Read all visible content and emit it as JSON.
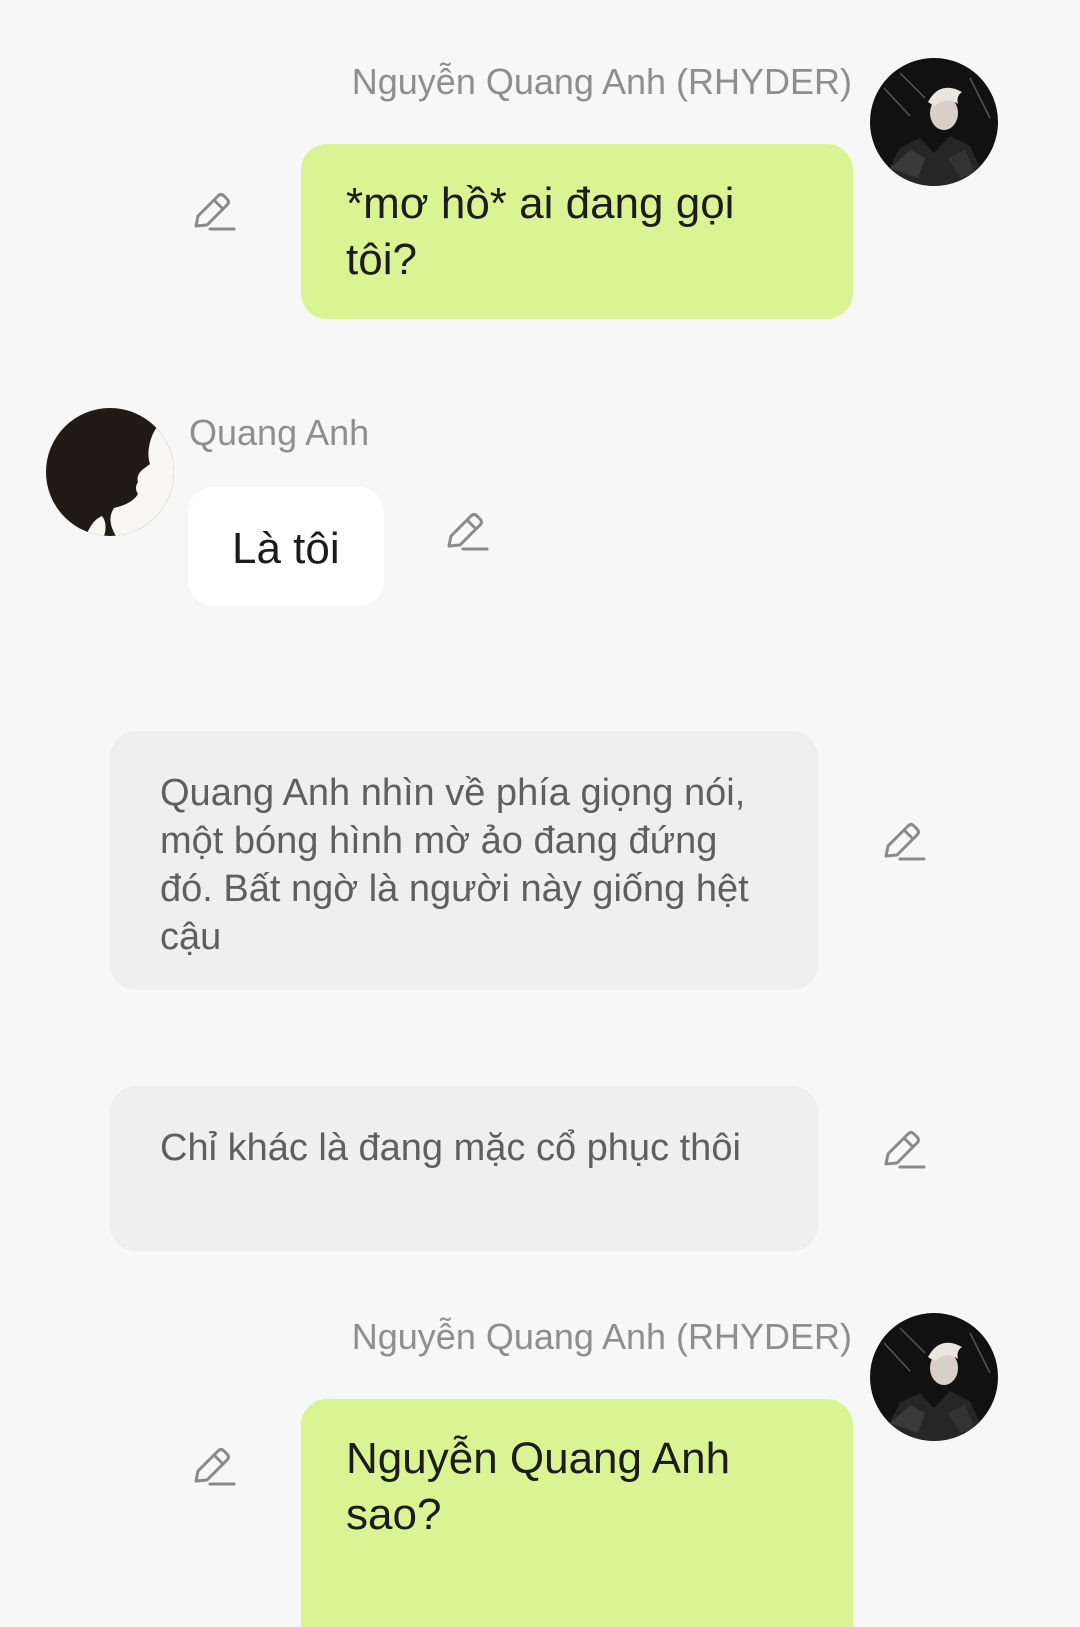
{
  "chat": {
    "messages": [
      {
        "type": "user",
        "name": "Nguyễn Quang Anh (RHYDER)",
        "avatar_icon": "dark-portrait-avatar",
        "text": "*mơ hồ* ai đang gọi tôi?"
      },
      {
        "type": "character",
        "name": "Quang Anh",
        "avatar_icon": "silhouette-avatar",
        "text": "Là tôi"
      },
      {
        "type": "narration",
        "text": "Quang Anh nhìn về phía giọng nói, một bóng hình mờ ảo đang đứng đó. Bất ngờ là người này giống hệt cậu"
      },
      {
        "type": "narration",
        "text": "Chỉ khác là đang mặc cổ phục thôi"
      },
      {
        "type": "user",
        "name": "Nguyễn Quang Anh (RHYDER)",
        "avatar_icon": "dark-portrait-avatar",
        "text": "Nguyễn Quang Anh sao?"
      }
    ],
    "edit_icon": "pencil-edit-icon"
  },
  "colors": {
    "background": "#f7f7f7",
    "user_bubble": "#d9f593",
    "character_bubble": "#ffffff",
    "narration_bubble": "#efefef",
    "name_text": "#8e8e8e",
    "icon": "#8a8a8a"
  }
}
